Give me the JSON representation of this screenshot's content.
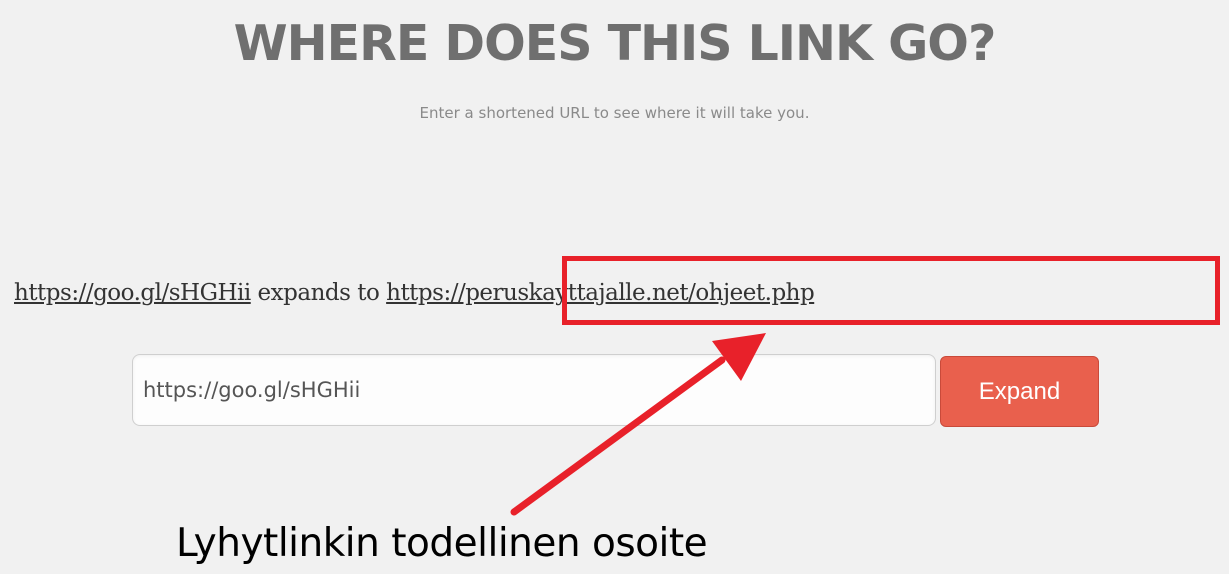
{
  "header": {
    "title": "WHERE DOES THIS LINK GO?",
    "subtitle": "Enter a shortened URL to see where it will take you."
  },
  "result": {
    "short_url": "https://goo.gl/sHGHii",
    "connector": " expands to ",
    "expanded_url": "https://peruskayttajalle.net/ohjeet.php"
  },
  "form": {
    "input_value": "https://goo.gl/sHGHii",
    "button_label": "Expand"
  },
  "annotation": {
    "caption": "Lyhytlinkin todellinen osoite",
    "color": "#e8212a"
  }
}
